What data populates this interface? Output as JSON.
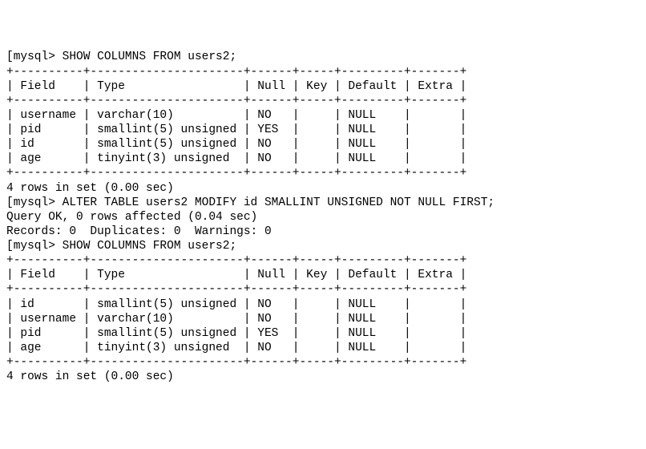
{
  "prompt": "mysql>",
  "commands": {
    "show1": "SHOW COLUMNS FROM users2;",
    "alter": "ALTER TABLE users2 MODIFY id SMALLINT UNSIGNED NOT NULL FIRST;",
    "show2": "SHOW COLUMNS FROM users2;"
  },
  "table1": {
    "header": {
      "field": "Field",
      "type": "Type",
      "null": "Null",
      "key": "Key",
      "default": "Default",
      "extra": "Extra"
    },
    "rows": [
      {
        "field": "username",
        "type": "varchar(10)",
        "null": "NO",
        "key": "",
        "default": "NULL",
        "extra": ""
      },
      {
        "field": "pid",
        "type": "smallint(5) unsigned",
        "null": "YES",
        "key": "",
        "default": "NULL",
        "extra": ""
      },
      {
        "field": "id",
        "type": "smallint(5) unsigned",
        "null": "NO",
        "key": "",
        "default": "NULL",
        "extra": ""
      },
      {
        "field": "age",
        "type": "tinyint(3) unsigned",
        "null": "NO",
        "key": "",
        "default": "NULL",
        "extra": ""
      }
    ],
    "summary": "4 rows in set (0.00 sec)"
  },
  "alter_result": {
    "line1": "Query OK, 0 rows affected (0.04 sec)",
    "line2": "Records: 0  Duplicates: 0  Warnings: 0"
  },
  "table2": {
    "header": {
      "field": "Field",
      "type": "Type",
      "null": "Null",
      "key": "Key",
      "default": "Default",
      "extra": "Extra"
    },
    "rows": [
      {
        "field": "id",
        "type": "smallint(5) unsigned",
        "null": "NO",
        "key": "",
        "default": "NULL",
        "extra": ""
      },
      {
        "field": "username",
        "type": "varchar(10)",
        "null": "NO",
        "key": "",
        "default": "NULL",
        "extra": ""
      },
      {
        "field": "pid",
        "type": "smallint(5) unsigned",
        "null": "YES",
        "key": "",
        "default": "NULL",
        "extra": ""
      },
      {
        "field": "age",
        "type": "tinyint(3) unsigned",
        "null": "NO",
        "key": "",
        "default": "NULL",
        "extra": ""
      }
    ],
    "summary": "4 rows in set (0.00 sec)"
  },
  "widths": {
    "field": 10,
    "type": 22,
    "null": 6,
    "key": 5,
    "default": 9,
    "extra": 7
  }
}
